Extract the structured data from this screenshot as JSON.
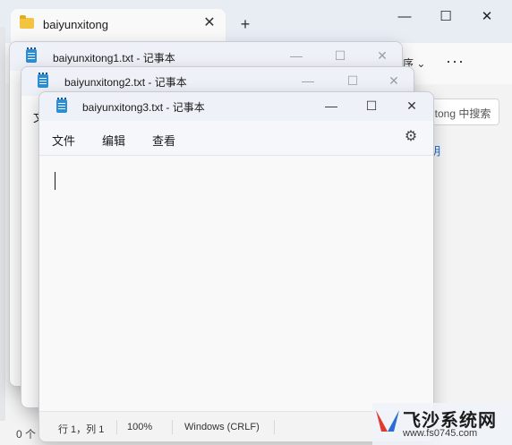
{
  "explorer": {
    "tab_title": "baiyunxitong",
    "tab_close": "✕",
    "new_tab": "+",
    "minimize": "—",
    "maximize": "☐",
    "close": "✕",
    "partial_menu": "序 ⌄",
    "more": "···",
    "search_placeholder": "itong 中搜索",
    "blue_link": "明",
    "status_partial": "0 个"
  },
  "notepads": [
    {
      "title": "baiyunxitong1.txt - 记事本",
      "minimize": "—",
      "maximize": "☐",
      "close": "✕"
    },
    {
      "title": "baiyunxitong2.txt - 记事本",
      "minimize": "—",
      "maximize": "☐",
      "close": "✕",
      "menu_partial": "文"
    },
    {
      "title": "baiyunxitong3.txt - 记事本",
      "minimize": "—",
      "maximize": "☐",
      "close": "✕",
      "menu": [
        "文件",
        "编辑",
        "查看"
      ],
      "status": {
        "position": "行 1，列 1",
        "zoom": "100%",
        "line_ending": "Windows (CRLF)"
      }
    }
  ],
  "watermark": {
    "title": "飞沙系统网",
    "url": "www.fs0745.com"
  },
  "colors": {
    "accent_blue": "#2b8fd6",
    "folder_yellow": "#f2c442",
    "logo_red": "#e03a2f",
    "logo_blue": "#2a6fd1"
  }
}
